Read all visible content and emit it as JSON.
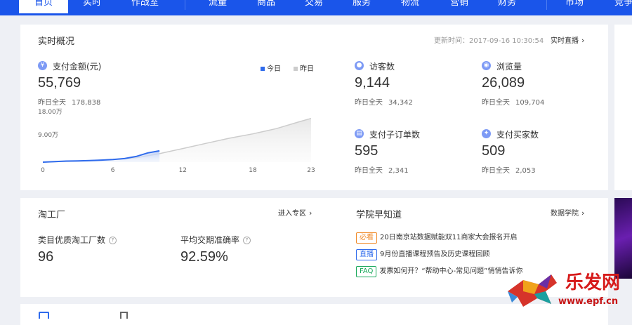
{
  "nav": {
    "items": [
      {
        "label": "首页",
        "active": true
      },
      {
        "label": "实时"
      },
      {
        "label": "作战室"
      },
      {
        "label": "流量"
      },
      {
        "label": "商品"
      },
      {
        "label": "交易"
      },
      {
        "label": "服务"
      },
      {
        "label": "物流"
      },
      {
        "label": "营销"
      },
      {
        "label": "财务"
      },
      {
        "label": "市场"
      },
      {
        "label": "竞争"
      }
    ]
  },
  "realtime": {
    "title": "实时概况",
    "update_label": "更新时间：2017-09-16 10:30:54",
    "live_link": "实时直播",
    "pay": {
      "label": "支付金额(元)",
      "value": "55,769",
      "yesterday_label": "昨日全天",
      "yesterday_value": "178,838"
    },
    "legend": {
      "today": "今日",
      "yesterday": "昨日"
    },
    "metrics": [
      {
        "label": "访客数",
        "value": "9,144",
        "yesterday_label": "昨日全天",
        "yesterday_value": "34,342",
        "icon": "footprint-icon"
      },
      {
        "label": "浏览量",
        "value": "26,089",
        "yesterday_label": "昨日全天",
        "yesterday_value": "109,704",
        "icon": "eye-icon"
      },
      {
        "label": "支付子订单数",
        "value": "595",
        "yesterday_label": "昨日全天",
        "yesterday_value": "2,341",
        "icon": "order-icon"
      },
      {
        "label": "支付买家数",
        "value": "509",
        "yesterday_label": "昨日全天",
        "yesterday_value": "2,053",
        "icon": "buyers-icon"
      }
    ]
  },
  "chart_data": {
    "type": "area",
    "x_ticks": [
      "0",
      "6",
      "12",
      "18",
      "23"
    ],
    "y_ticks": [
      "9.00万",
      "18.00万"
    ],
    "ylim": [
      0,
      18
    ],
    "series": [
      {
        "name": "今日",
        "color": "#2f6bec",
        "x": [
          0,
          1,
          2,
          3,
          4,
          5,
          6,
          7,
          8,
          9,
          10
        ],
        "y": [
          0,
          0.2,
          0.4,
          0.5,
          0.6,
          0.8,
          1.0,
          1.4,
          2.2,
          3.6,
          4.4
        ]
      },
      {
        "name": "昨日",
        "color": "#cccccc",
        "x": [
          0,
          2,
          4,
          6,
          8,
          10,
          12,
          14,
          16,
          18,
          20,
          22,
          23
        ],
        "y": [
          0,
          0.3,
          0.6,
          1.0,
          1.7,
          3.3,
          5.3,
          7.3,
          9.3,
          11.0,
          13.0,
          15.7,
          17.0
        ]
      }
    ]
  },
  "factory": {
    "title": "淘工厂",
    "link": "进入专区",
    "metric1_label": "类目优质淘工厂数",
    "metric1_value": "96",
    "metric2_label": "平均交期准确率",
    "metric2_value": "92.59%"
  },
  "academy": {
    "title": "学院早知道",
    "link": "数据学院",
    "news": [
      {
        "tag": "必看",
        "tag_color": "#f08a28",
        "text": "20日南京站数据赋能双11商家大会报名开启"
      },
      {
        "tag": "直播",
        "tag_color": "#2f6bec",
        "text": "9月份直播课程预告及历史课程回顾"
      },
      {
        "tag": "FAQ",
        "tag_color": "#18a85a",
        "text": "发票如何开？“帮助中心-常见问题”悄悄告诉你"
      }
    ]
  },
  "watermark": {
    "brand": "乐发网",
    "url": "www.epf.cn"
  }
}
